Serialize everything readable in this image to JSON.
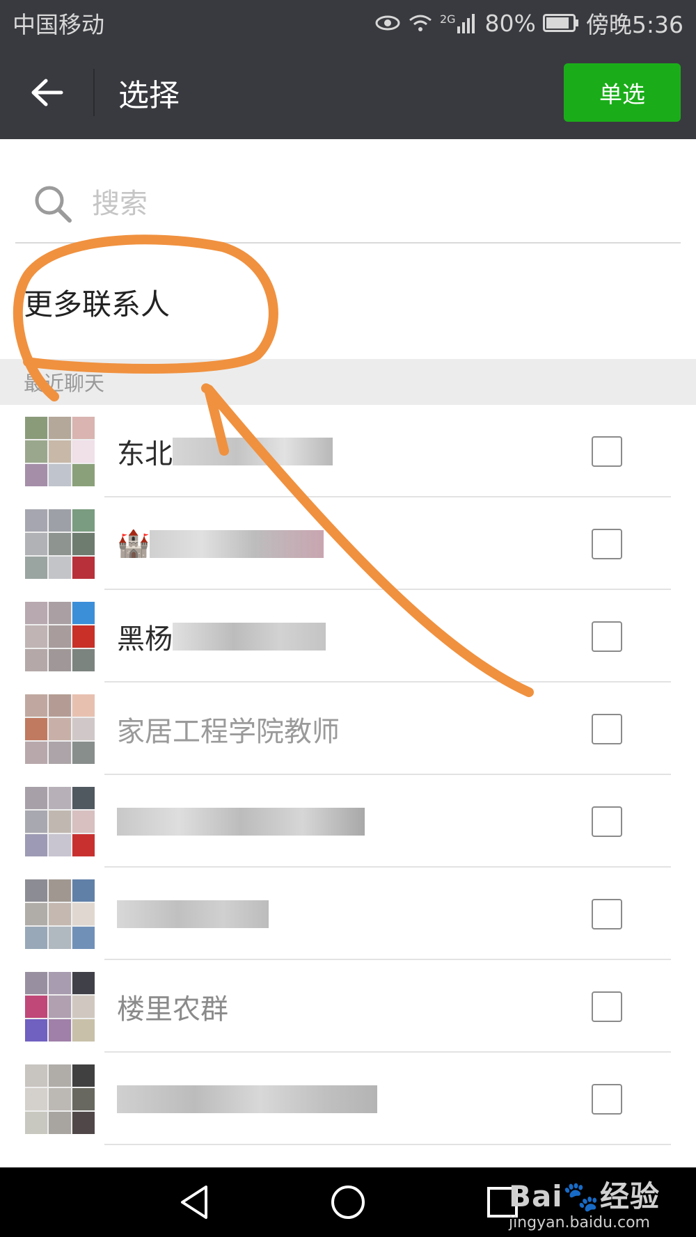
{
  "status_bar": {
    "carrier": "中国移动",
    "network": "2G",
    "battery_pct": "80%",
    "time": "傍晚5:36"
  },
  "header": {
    "back_icon": "arrow-left-icon",
    "title": "选择",
    "single_select_label": "单选",
    "accent_color": "#1aad19"
  },
  "search": {
    "placeholder": "搜索",
    "value": ""
  },
  "more_contacts_label": "更多联系人",
  "recent_section_label": "最近聊天",
  "chats": [
    {
      "name_visible": "东北",
      "checked": false
    },
    {
      "name_visible": "",
      "checked": false
    },
    {
      "name_visible": "黑杨",
      "checked": false
    },
    {
      "name_visible": "家居工程学院教师",
      "checked": false
    },
    {
      "name_visible": "",
      "checked": false
    },
    {
      "name_visible": "",
      "checked": false
    },
    {
      "name_visible": "楼里农群",
      "checked": false
    },
    {
      "name_visible": "",
      "checked": false
    }
  ],
  "nav_bar": {
    "back": "triangle-back-icon",
    "home": "circle-home-icon",
    "recent": "square-recent-icon"
  },
  "watermark": {
    "brand": "Bai🐾经验",
    "url": "jingyan.baidu.com"
  },
  "annotation_color": "#f0913f"
}
